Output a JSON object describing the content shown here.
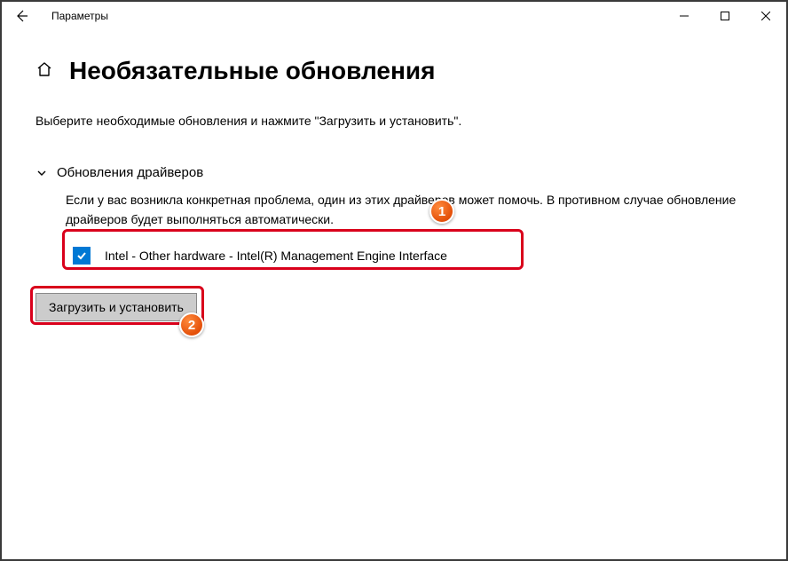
{
  "titlebar": {
    "app_name": "Параметры"
  },
  "page": {
    "title": "Необязательные обновления",
    "instruction": "Выберите необходимые обновления и нажмите \"Загрузить и установить\"."
  },
  "section": {
    "title": "Обновления драйверов",
    "description": "Если у вас возникла конкретная проблема, один из этих драйверов может помочь. В противном случае обновление драйверов будет выполняться автоматически."
  },
  "updates": [
    {
      "checked": true,
      "label": "Intel - Other hardware - Intel(R) Management Engine Interface"
    }
  ],
  "actions": {
    "install_label": "Загрузить и установить"
  },
  "annotations": {
    "badge1": "1",
    "badge2": "2"
  }
}
